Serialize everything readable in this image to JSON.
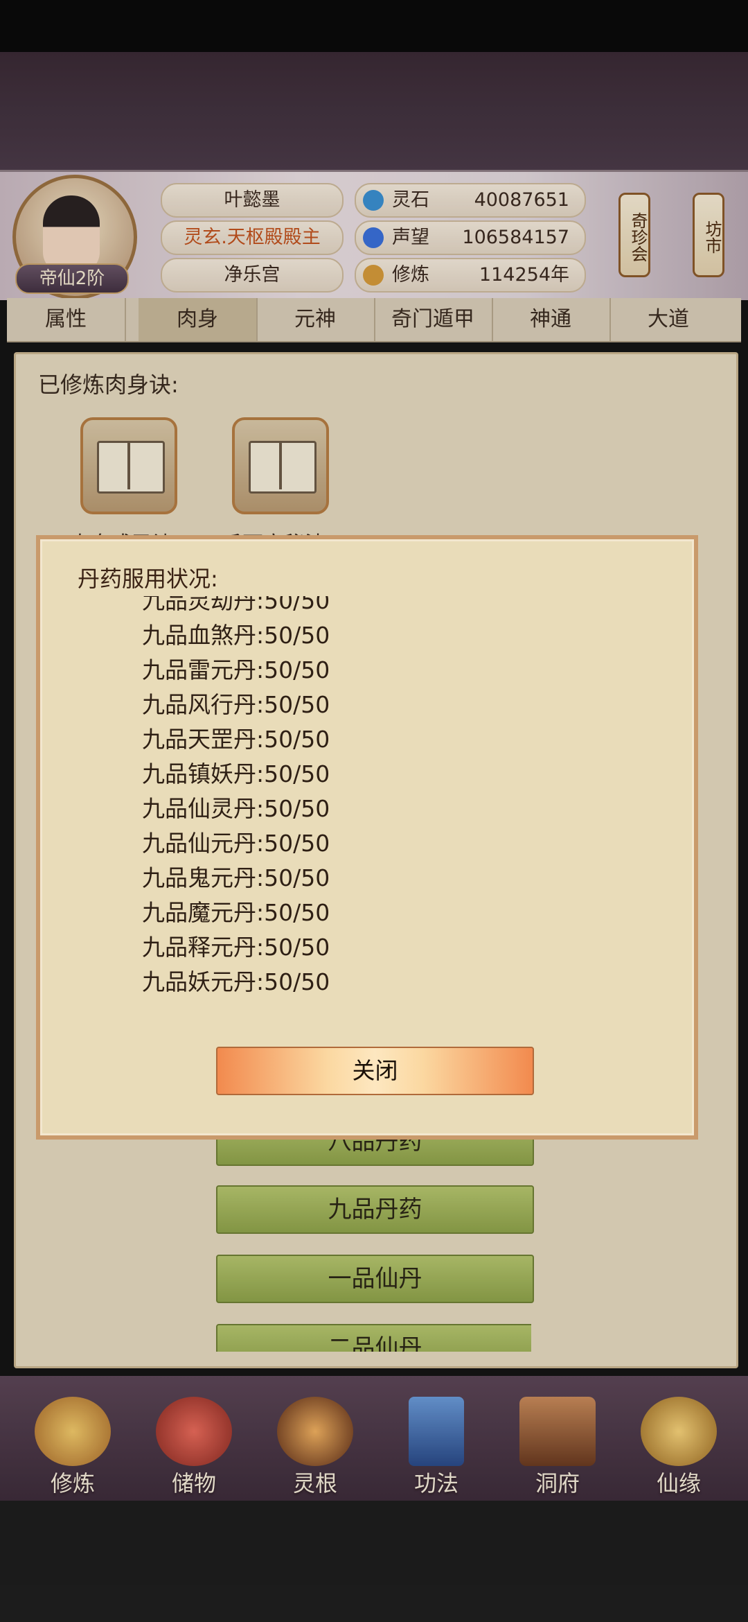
{
  "header": {
    "player_name": "叶懿墨",
    "title": "灵玄.天枢殿殿主",
    "sect": "净乐宫",
    "rank": "帝仙2阶",
    "resources": [
      {
        "label": "灵石",
        "value": "40087651",
        "icon": "spirit-stone-icon",
        "color": "#3a8fd0"
      },
      {
        "label": "声望",
        "value": "106584157",
        "icon": "reputation-icon",
        "color": "#3a6fd8"
      },
      {
        "label": "修炼",
        "value": "114254年",
        "icon": "cultivation-icon",
        "color": "#d49a3a"
      }
    ],
    "side_buttons": [
      {
        "label": "奇珍会"
      },
      {
        "label": "坊市"
      }
    ]
  },
  "tabs": [
    {
      "label": "属性",
      "active": false
    },
    {
      "label": "肉身",
      "active": true
    },
    {
      "label": "元神",
      "active": false
    },
    {
      "label": "奇门遁甲",
      "active": false
    },
    {
      "label": "神通",
      "active": false
    },
    {
      "label": "大道",
      "active": false
    }
  ],
  "main": {
    "learned_title": "已修炼肉身诀:",
    "books": [
      {
        "label": "肉身成圣诀"
      },
      {
        "label": "千面寂秘法"
      }
    ],
    "category_buttons": [
      {
        "label": "八品丹药"
      },
      {
        "label": "九品丹药"
      },
      {
        "label": "一品仙丹"
      },
      {
        "label": "二品仙丹"
      }
    ]
  },
  "dialog": {
    "title": "丹药服用状况:",
    "rows": [
      {
        "name": "九品灵劫丹",
        "value": "50/50"
      },
      {
        "name": "九品血煞丹",
        "value": "50/50"
      },
      {
        "name": "九品雷元丹",
        "value": "50/50"
      },
      {
        "name": "九品风行丹",
        "value": "50/50"
      },
      {
        "name": "九品天罡丹",
        "value": "50/50"
      },
      {
        "name": "九品镇妖丹",
        "value": "50/50"
      },
      {
        "name": "九品仙灵丹",
        "value": "50/50"
      },
      {
        "name": "九品仙元丹",
        "value": "50/50"
      },
      {
        "name": "九品鬼元丹",
        "value": "50/50"
      },
      {
        "name": "九品魔元丹",
        "value": "50/50"
      },
      {
        "name": "九品释元丹",
        "value": "50/50"
      },
      {
        "name": "九品妖元丹",
        "value": "50/50"
      }
    ],
    "close_label": "关闭",
    "separator": ":"
  },
  "bottom_nav": [
    {
      "label": "修炼",
      "icon": "cultivate-icon",
      "color": "#d9a43e"
    },
    {
      "label": "储物",
      "icon": "storage-bag-icon",
      "color": "#c9443e"
    },
    {
      "label": "灵根",
      "icon": "spirit-root-icon",
      "color": "#8a4a2a"
    },
    {
      "label": "功法",
      "icon": "technique-book-icon",
      "color": "#3a6aa8"
    },
    {
      "label": "洞府",
      "icon": "cave-dwelling-icon",
      "color": "#a8573a"
    },
    {
      "label": "仙缘",
      "icon": "immortal-fate-icon",
      "color": "#e0b04a"
    }
  ]
}
